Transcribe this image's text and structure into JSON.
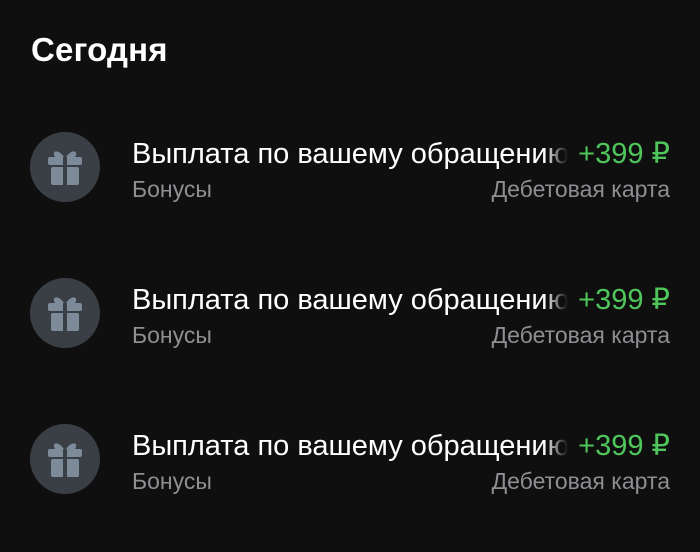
{
  "section": {
    "title": "Сегодня"
  },
  "transactions": [
    {
      "icon": "gift-icon",
      "title": "Выплата по вашему обращению",
      "amount": "+399 ₽",
      "category": "Бонусы",
      "account": "Дебетовая карта"
    },
    {
      "icon": "gift-icon",
      "title": "Выплата по вашему обращению",
      "amount": "+399 ₽",
      "category": "Бонусы",
      "account": "Дебетовая карта"
    },
    {
      "icon": "gift-icon",
      "title": "Выплата по вашему обращению",
      "amount": "+399 ₽",
      "category": "Бонусы",
      "account": "Дебетовая карта"
    }
  ],
  "colors": {
    "background": "#0f0f0f",
    "icon_circle": "#3a3f45",
    "icon_glyph": "#7d8a9a",
    "amount_positive": "#4fc65b",
    "secondary_text": "#8e8e93"
  }
}
